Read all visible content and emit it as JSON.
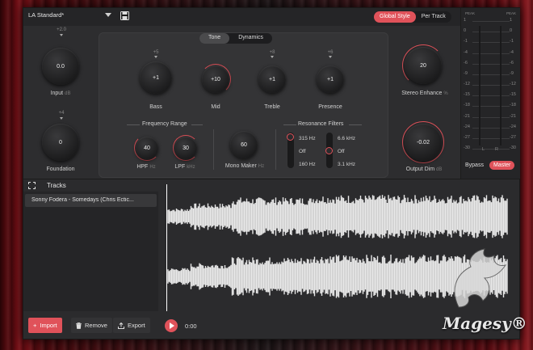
{
  "topbar": {
    "preset": "LA Standard*",
    "mode_tabs": [
      "Global Style",
      "Per Track"
    ],
    "active_mode": "Global Style"
  },
  "left": {
    "input": {
      "value": "0.0",
      "label": "Input",
      "unit": "dB",
      "max_tick": "+2.0"
    },
    "foundation": {
      "value": "0",
      "label": "Foundation",
      "max_tick": "+4"
    }
  },
  "subtabs": [
    "Tone",
    "Dynamics"
  ],
  "tone": {
    "bass": {
      "value": "+1",
      "label": "Bass",
      "tick": "+5"
    },
    "mid": {
      "value": "+10",
      "label": "Mid"
    },
    "treble": {
      "value": "+1",
      "label": "Treble",
      "tick": "+8"
    },
    "presence": {
      "value": "+1",
      "label": "Presence",
      "tick": "+6"
    }
  },
  "frequency_range": {
    "title": "Frequency Range",
    "hpf": {
      "value": "40",
      "label": "HPF",
      "unit": "Hz"
    },
    "lpf": {
      "value": "30",
      "label": "LPF",
      "unit": "kHz"
    }
  },
  "mono_maker": {
    "value": "60",
    "label": "Mono Maker",
    "unit": "Hz"
  },
  "resonance": {
    "title": "Resonance Filters",
    "left": {
      "top": "315 Hz",
      "mid": "Off",
      "bottom": "160 Hz"
    },
    "right": {
      "top": "6.6 kHz",
      "mid": "Off",
      "bottom": "3.1 kHz"
    }
  },
  "right": {
    "stereo": {
      "value": "20",
      "label": "Stereo Enhance",
      "unit": "%"
    },
    "output": {
      "value": "-0.02",
      "label": "Output Dim",
      "unit": "dB"
    }
  },
  "meter": {
    "head_left": "PEAK",
    "head_right": "PEAK",
    "scale_left": [
      "1",
      "0",
      "-1",
      "-4",
      "-6",
      "-9",
      "-12",
      "-15",
      "-18",
      "-21",
      "-24",
      "-27",
      "-30"
    ],
    "scale_right": [
      "1",
      "0",
      "-1",
      "-4",
      "-6",
      "-9",
      "-12",
      "-15",
      "-18",
      "-21",
      "-24",
      "-27",
      "-30"
    ],
    "bottom_left": "L",
    "bottom_right": "R"
  },
  "bypass": {
    "label": "Bypass",
    "master": "Master"
  },
  "tracks": {
    "title": "Tracks",
    "items": [
      "Sonny Fodera - Somedays (Chris Ectic..."
    ]
  },
  "bottom": {
    "import": "Import",
    "remove": "Remove",
    "export": "Export",
    "time": "0:00"
  },
  "brand": {
    "name": "Magesy®"
  },
  "colors": {
    "accent": "#e0525a",
    "panel": "#2b2b2d"
  }
}
